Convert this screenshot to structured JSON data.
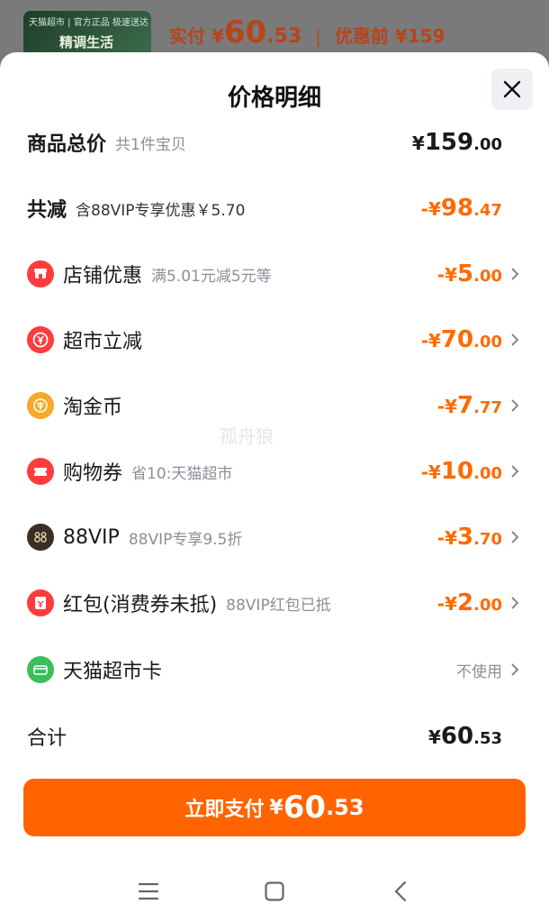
{
  "background": {
    "thumb_line1": "天猫超市 | 官方正品 极速送达",
    "thumb_line2": "精调生活",
    "pay_label": "实付",
    "pay_yen": "¥",
    "pay_int": "60",
    "pay_dec": ".53",
    "separator": "|",
    "before_label": "优惠前",
    "before_amount": "¥159"
  },
  "sheet": {
    "title": "价格明细",
    "close_icon": "close-icon"
  },
  "rows": {
    "total": {
      "label": "商品总价",
      "desc": "共1件宝贝",
      "yen": "¥",
      "int": "159",
      "dec": ".00"
    },
    "discount": {
      "label": "共减",
      "desc": "含88VIP专享优惠￥5.70",
      "prefix": "-¥",
      "int": "98",
      "dec": ".47"
    },
    "shop": {
      "label": "店铺优惠",
      "desc": "满5.01元减5元等",
      "prefix": "-¥",
      "int": "5",
      "dec": ".00",
      "icon": "shop-coupon-icon",
      "color": "#ff3b3b"
    },
    "market": {
      "label": "超市立减",
      "desc": "",
      "prefix": "-¥",
      "int": "70",
      "dec": ".00",
      "icon": "yen-discount-icon",
      "color": "#ff3b3b"
    },
    "coin": {
      "label": "淘金币",
      "desc": "",
      "prefix": "-¥",
      "int": "7",
      "dec": ".77",
      "icon": "coin-icon",
      "color": "#f7a928"
    },
    "voucher": {
      "label": "购物券",
      "desc": "省10:天猫超市",
      "prefix": "-¥",
      "int": "10",
      "dec": ".00",
      "icon": "voucher-icon",
      "color": "#ff3b3b"
    },
    "vip": {
      "label": "88VIP",
      "desc": "88VIP专享9.5折",
      "prefix": "-¥",
      "int": "3",
      "dec": ".70",
      "icon": "vip-88-icon",
      "color": "#3a2e25"
    },
    "redpack": {
      "label": "红包(消费券未抵)",
      "desc": "88VIP红包已抵",
      "prefix": "-¥",
      "int": "2",
      "dec": ".00",
      "icon": "red-packet-icon",
      "color": "#ff3b3b"
    },
    "card": {
      "label": "天猫超市卡",
      "desc": "",
      "link": "不使用",
      "icon": "supermarket-card-icon",
      "color": "#3cbf5a"
    },
    "sum": {
      "label": "合计",
      "yen": "¥",
      "int": "60",
      "dec": ".53"
    }
  },
  "watermark": "孤舟狼",
  "pay_button": {
    "label": "立即支付",
    "yen": "¥",
    "int": "60",
    "dec": ".53"
  },
  "navbar": {
    "menu_icon": "menu-icon",
    "home_icon": "home-icon",
    "back_icon": "back-icon"
  },
  "colors": {
    "accent": "#ff6400",
    "discount": "#ff6a00",
    "muted": "#8a8f99"
  }
}
